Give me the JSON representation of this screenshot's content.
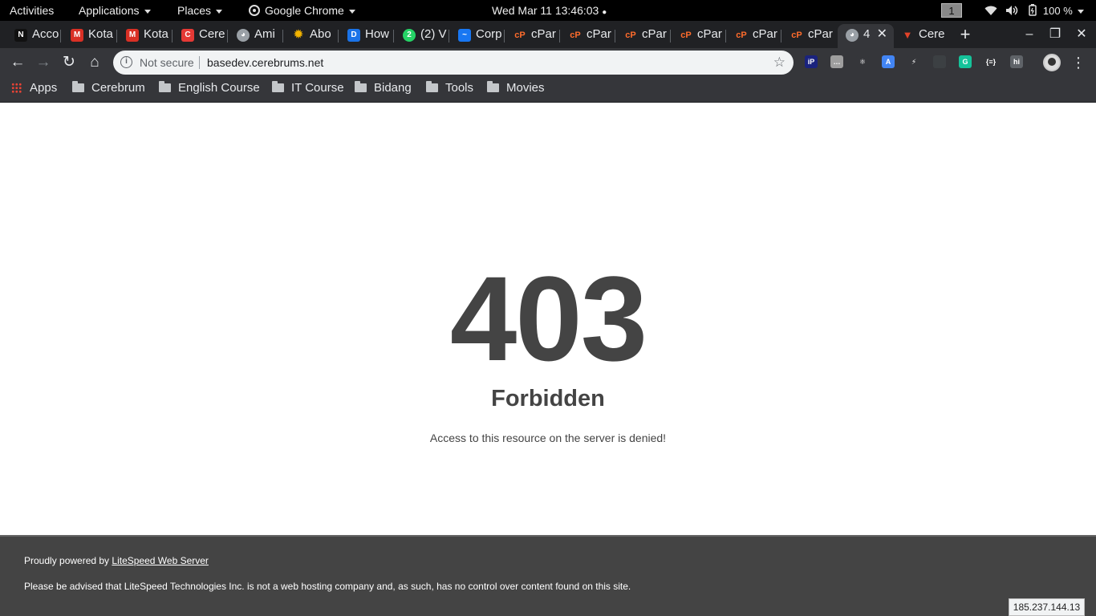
{
  "topbar": {
    "activities": "Activities",
    "applications": "Applications",
    "places": "Places",
    "app_name": "Google Chrome",
    "clock": "Wed Mar 11  13:46:03",
    "workspace": "1",
    "battery": "100 %"
  },
  "tabs": [
    {
      "title": "Acco",
      "favicon": "N",
      "color": "#111111"
    },
    {
      "title": "Kota",
      "favicon": "M",
      "color": "#d93025"
    },
    {
      "title": "Kota",
      "favicon": "M",
      "color": "#d93025"
    },
    {
      "title": "Cere",
      "favicon": "C",
      "color": "#e53935"
    },
    {
      "title": "Ami",
      "favicon": "globe",
      "color": "#9aa0a6"
    },
    {
      "title": "Abo",
      "favicon": "sun",
      "color": "#f4b400"
    },
    {
      "title": "How",
      "favicon": "D",
      "color": "#1a73e8"
    },
    {
      "title": "(2) V",
      "favicon": "2",
      "color": "#25d366"
    },
    {
      "title": "Corp",
      "favicon": "~",
      "color": "#1877f2"
    },
    {
      "title": "cPar",
      "favicon": "cP",
      "color": "#ff6c2c"
    },
    {
      "title": "cPar",
      "favicon": "cP",
      "color": "#ff6c2c"
    },
    {
      "title": "cPar",
      "favicon": "cP",
      "color": "#ff6c2c"
    },
    {
      "title": "cPar",
      "favicon": "cP",
      "color": "#ff6c2c"
    },
    {
      "title": "cPar",
      "favicon": "cP",
      "color": "#ff6c2c"
    },
    {
      "title": "cPar",
      "favicon": "cP",
      "color": "#ff6c2c"
    },
    {
      "title": "4",
      "favicon": "globe",
      "color": "#9aa0a6",
      "active": true
    },
    {
      "title": "Cere",
      "favicon": "fox",
      "color": "#e24329"
    }
  ],
  "toolbar": {
    "security_label": "Not secure",
    "url": "basedev.cerebrums.net"
  },
  "extensions": [
    {
      "name": "ip-icon",
      "label": "iP",
      "color": "#1a237e"
    },
    {
      "name": "chat-icon",
      "label": "…",
      "color": "#9e9e9e"
    },
    {
      "name": "react-icon",
      "label": "⚛",
      "color": "#35363a"
    },
    {
      "name": "translate-icon",
      "label": "A",
      "color": "#4285f4"
    },
    {
      "name": "bolt-icon",
      "label": "⚡",
      "color": "#35363a"
    },
    {
      "name": "puzzle-icon",
      "label": "",
      "color": "#3c4043"
    },
    {
      "name": "grammarly-icon",
      "label": "G",
      "color": "#15c39a"
    },
    {
      "name": "json-icon",
      "label": "{≡}",
      "color": "#35363a"
    },
    {
      "name": "hola-icon",
      "label": "hi",
      "color": "#5f6368"
    }
  ],
  "bookmarks": {
    "apps": "Apps",
    "folders": [
      "Cerebrum",
      "English Course",
      "IT Course",
      "Bidang",
      "Tools",
      "Movies"
    ]
  },
  "page": {
    "code": "403",
    "title": "Forbidden",
    "message": "Access to this resource on the server is denied!",
    "footer_prefix": "Proudly powered by ",
    "footer_link": "LiteSpeed Web Server",
    "footer_notice": "Please be advised that LiteSpeed Technologies Inc. is not a web hosting company and, as such, has no control over content found on this site.",
    "ip": "185.237.144.13"
  }
}
